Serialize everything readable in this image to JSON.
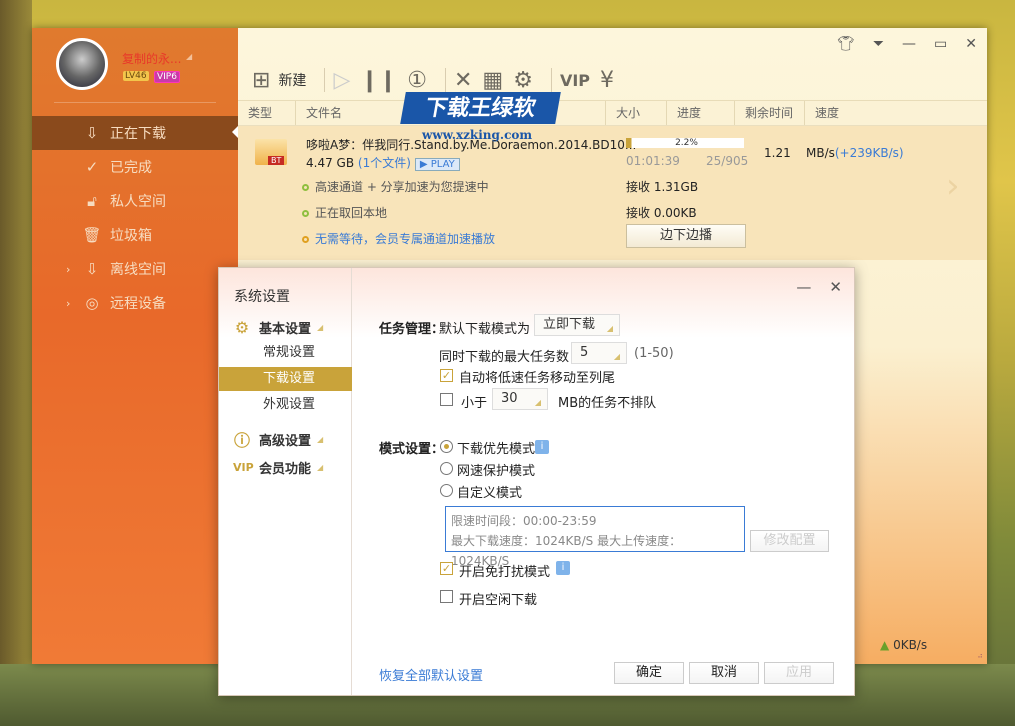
{
  "user": {
    "name": "复制的永...",
    "level": "LV46",
    "vip": "VIP6"
  },
  "sidebar": {
    "items": [
      {
        "label": "正在下载",
        "icon": "download-icon"
      },
      {
        "label": "已完成",
        "icon": "check-circle-icon"
      },
      {
        "label": "私人空间",
        "icon": "lock-icon"
      },
      {
        "label": "垃圾箱",
        "icon": "trash-icon"
      },
      {
        "label": "离线空间",
        "icon": "offline-download-icon"
      },
      {
        "label": "远程设备",
        "icon": "globe-icon"
      }
    ]
  },
  "toolbar": {
    "new_label": "新建"
  },
  "columns": [
    "类型",
    "文件名",
    "大小",
    "进度",
    "剩余时间",
    "速度"
  ],
  "task": {
    "type_badge": "BT",
    "name": "哆啦A梦：伴我同行.Stand.by.Me.Doraemon.2014.BD10...",
    "size": "4.47 GB",
    "file_count": "(1个文件)",
    "play": "PLAY",
    "progress_label": "2.2%",
    "progress": 2.2,
    "remaining": "01:01:39",
    "pieces": "25/905",
    "speed": "1.21",
    "speed_unit": "MB/s",
    "speed_bonus": "(+239KB/s)",
    "status1": "高速通道 + 分享加速为您提速中",
    "status2": "正在取回本地",
    "status3": "无需等待，会员专属通道加速播放",
    "recv1": "接收 1.31GB",
    "recv2": "接收 0.00KB",
    "play_button": "边下边播"
  },
  "statusbar": {
    "upload": "0KB/s"
  },
  "watermark": {
    "title": "下载王绿软",
    "url": "www.xzking.com"
  },
  "dialog": {
    "title": "系统设置",
    "groups": [
      {
        "label": "基本设置",
        "items": [
          "常规设置",
          "下载设置",
          "外观设置"
        ]
      },
      {
        "label": "高级设置"
      },
      {
        "label": "会员功能"
      }
    ],
    "task_mgmt_label": "任务管理：",
    "default_mode_label": "默认下载模式为",
    "default_mode": "立即下载",
    "max_tasks_label": "同时下载的最大任务数",
    "max_tasks": "5",
    "max_tasks_range": "(1-50)",
    "auto_move_label": "自动将低速任务移动至列尾",
    "auto_move": true,
    "small_label": "小于",
    "small_value": "30",
    "small_suffix": "MB的任务不排队",
    "small_checked": false,
    "mode_label": "模式设置：",
    "modes": [
      "下载优先模式",
      "网速保护模式",
      "自定义模式"
    ],
    "mode_selected": 0,
    "limit_time": "限速时间段：00:00-23:59",
    "limit_speed": "最大下载速度：1024KB/S  最大上传速度：1024KB/S",
    "modify_button": "修改配置",
    "dnd_label": "开启免打扰模式",
    "dnd": true,
    "idle_label": "开启空闲下载",
    "idle": false,
    "restore_link": "恢复全部默认设置",
    "ok": "确定",
    "cancel": "取消",
    "apply": "应用"
  }
}
